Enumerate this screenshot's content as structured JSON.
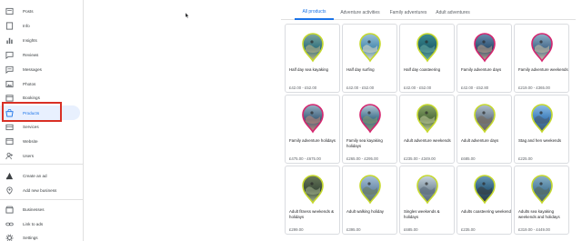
{
  "sidebar": {
    "items": [
      {
        "label": "Posts",
        "icon": "posts-icon"
      },
      {
        "label": "Info",
        "icon": "info-icon"
      },
      {
        "label": "Insights",
        "icon": "insights-icon"
      },
      {
        "label": "Reviews",
        "icon": "reviews-icon"
      },
      {
        "label": "Messages",
        "icon": "messages-icon"
      },
      {
        "label": "Photos",
        "icon": "photos-icon"
      },
      {
        "label": "Bookings",
        "icon": "bookings-icon"
      },
      {
        "label": "Products",
        "icon": "products-icon",
        "active": true
      },
      {
        "label": "Services",
        "icon": "services-icon"
      },
      {
        "label": "Website",
        "icon": "website-icon"
      },
      {
        "label": "Users",
        "icon": "users-icon"
      },
      {
        "label": "Create an ad",
        "icon": "ads-icon"
      },
      {
        "label": "Add new business",
        "icon": "add-business-icon"
      },
      {
        "label": "Businesses",
        "icon": "businesses-icon"
      },
      {
        "label": "Link to ads",
        "icon": "link-icon"
      },
      {
        "label": "Settings",
        "icon": "settings-icon"
      }
    ]
  },
  "tabs": [
    {
      "label": "All products",
      "active": true
    },
    {
      "label": "Adventure activities"
    },
    {
      "label": "Family adventures"
    },
    {
      "label": "Adult adventures"
    }
  ],
  "products": [
    {
      "title": "Half day sea kayaking",
      "price": "£42.00 - £52.00",
      "pin_color": "#c6d92b"
    },
    {
      "title": "Half day surfing",
      "price": "£42.00 - £52.00",
      "pin_color": "#c6d92b"
    },
    {
      "title": "Half day coasteering",
      "price": "£42.00 - £52.00",
      "pin_color": "#c6d92b"
    },
    {
      "title": "Family adventure days",
      "price": "£42.00 - £52.80",
      "pin_color": "#d6246e"
    },
    {
      "title": "Family adventure weekends",
      "price": "£219.00 - £365.00",
      "pin_color": "#d6246e"
    },
    {
      "title": "Family adventure holidays",
      "price": "£475.00 - £675.00",
      "pin_color": "#d6246e"
    },
    {
      "title": "Family sea kayaking holidays",
      "price": "£265.00 - £295.00",
      "pin_color": "#d6246e"
    },
    {
      "title": "Adult adventure weekends",
      "price": "£235.00 - £349.00",
      "pin_color": "#c6d92b"
    },
    {
      "title": "Adult adventure days",
      "price": "£685.00",
      "pin_color": "#c6d92b"
    },
    {
      "title": "Stag and hen weekends",
      "price": "£225.00",
      "pin_color": "#c6d92b"
    },
    {
      "title": "Adult fitness weekends & holidays",
      "price": "£299.00",
      "pin_color": "#c6d92b"
    },
    {
      "title": "Adult walking holiday",
      "price": "£395.00",
      "pin_color": "#c6d92b"
    },
    {
      "title": "Singles weekends & holidays",
      "price": "£685.00",
      "pin_color": "#c6d92b"
    },
    {
      "title": "Adults coasteering weekend",
      "price": "£235.00",
      "pin_color": "#c6d92b"
    },
    {
      "title": "Adults sea kayaking weekends and holidays",
      "price": "£319.00 - £449.00",
      "pin_color": "#c6d92b"
    }
  ]
}
